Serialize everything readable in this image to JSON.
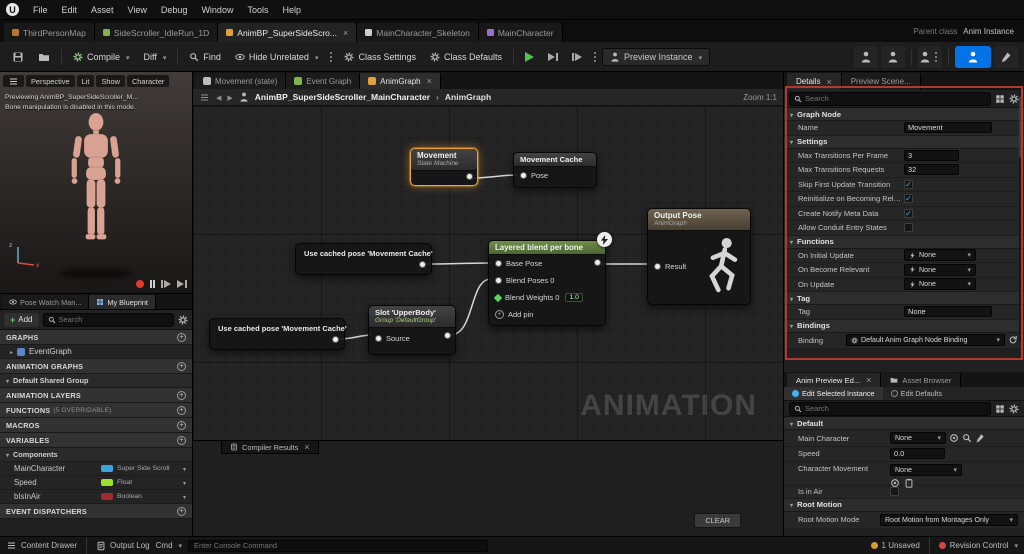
{
  "colors": {
    "accent_blue": "#0473e8",
    "selection_orange": "#f1a33a",
    "red_frame": "#b23a2d",
    "blend_green": "#6f904a",
    "pill_object": "#39a5dd",
    "pill_float": "#9ae42c",
    "pill_bool": "#9e2b2e"
  },
  "menubar": {
    "logo": "U",
    "items": [
      "File",
      "Edit",
      "Asset",
      "View",
      "Debug",
      "Window",
      "Tools",
      "Help"
    ]
  },
  "asset_tabs": {
    "tabs": [
      {
        "label": "ThirdPersonMap"
      },
      {
        "label": "SideScroller_IdleRun_1D"
      },
      {
        "label": "AnimBP_SuperSideScro..."
      },
      {
        "label": "MainCharacter_Skeleton"
      },
      {
        "label": "MainCharacter"
      }
    ],
    "parent_class_label": "Parent class",
    "parent_class_value": "Anim Instance"
  },
  "toolbar": {
    "compile_label": "Compile",
    "diff_label": "Diff",
    "find_label": "Find",
    "hide_unrelated_label": "Hide Unrelated",
    "class_settings_label": "Class Settings",
    "class_defaults_label": "Class Defaults",
    "preview_instance_label": "Preview Instance"
  },
  "viewport": {
    "menu_buttons": [
      "Perspective",
      "Lit",
      "Show",
      "Character"
    ],
    "preview_line1": "Previewing AnimBP_SuperSideScroller_M...",
    "preview_line2": "Bone manipulation is disabled in this mode.",
    "axis_x": "x",
    "axis_z": "z"
  },
  "left_panel": {
    "tab_pose_watch": "Pose Watch Man...",
    "tab_my_blueprint": "My Blueprint",
    "add_label": "Add",
    "search_placeholder": "Search",
    "graphs_header": "GRAPHS",
    "event_graph": "EventGraph",
    "animation_graphs_header": "ANIMATION GRAPHS",
    "default_shared_group": "Default Shared Group",
    "animation_layers_header": "ANIMATION LAYERS",
    "functions_header": "FUNCTIONS",
    "functions_suffix": "(5 OVERRIDABLE)",
    "macros_header": "MACROS",
    "variables_header": "VARIABLES",
    "components_label": "Components",
    "variables": [
      {
        "name": "MainCharacter",
        "type": "Super Side Scroll"
      },
      {
        "name": "Speed",
        "type": "Float"
      },
      {
        "name": "bIsInAir",
        "type": "Boolean"
      }
    ],
    "event_dispatchers_header": "EVENT DISPATCHERS"
  },
  "graph": {
    "tabs": [
      {
        "label": "Movement (state)"
      },
      {
        "label": "Event Graph"
      },
      {
        "label": "AnimGraph"
      }
    ],
    "breadcrumb_root": "AnimBP_SuperSideScroller_MainCharacter",
    "breadcrumb_sep": "›",
    "breadcrumb_current": "AnimGraph",
    "zoom_label": "Zoom 1:1",
    "watermark": "ANIMATION",
    "nodes": {
      "movement": {
        "title": "Movement",
        "subtitle": "State Machine"
      },
      "movement_cache": {
        "title": "Movement Cache",
        "pin": "Pose"
      },
      "cached_pose_top": {
        "title": "Use cached pose 'Movement Cache'"
      },
      "cached_pose_bottom": {
        "title": "Use cached pose 'Movement Cache'"
      },
      "layered_blend": {
        "title": "Layered blend per bone",
        "pin_base": "Base Pose",
        "pin_blend_poses": "Blend Poses 0",
        "pin_blend_weights": "Blend Weights 0",
        "weight_value": "1.0",
        "add_pin": "Add pin"
      },
      "output_pose": {
        "title": "Output Pose",
        "subtitle": "AnimGraph",
        "pin": "Result"
      },
      "slot": {
        "title": "Slot 'UpperBody'",
        "subtitle": "Group 'DefaultGroup'",
        "pin": "Source"
      }
    },
    "compiler_tab": "Compiler Results",
    "clear_label": "CLEAR"
  },
  "details": {
    "tab_details": "Details",
    "tab_preview_scene": "Preview Scene...",
    "search_placeholder": "Search",
    "graph_node_header": "Graph Node",
    "name_label": "Name",
    "name_value": "Movement",
    "settings_header": "Settings",
    "rows": {
      "max_transitions_label": "Max Transitions Per Frame",
      "max_transitions_value": "3",
      "max_requests_label": "Max Transitions Requests",
      "max_requests_value": "32",
      "skip_first_label": "Skip First Update Transition",
      "reinit_label": "Reinitialize on Becoming Relev...",
      "notify_label": "Create Notify Meta Data",
      "conduit_label": "Allow Conduit Entry States"
    },
    "functions_header": "Functions",
    "fn_initial_label": "On Initial Update",
    "fn_relevant_label": "On Become Relevant",
    "fn_update_label": "On Update",
    "fn_value": "None",
    "tag_header": "Tag",
    "tag_label": "Tag",
    "tag_value": "None",
    "bindings_header": "Bindings",
    "binding_label": "Binding",
    "binding_value": "Default Anim Graph Node Binding"
  },
  "anim_preview": {
    "tab_anim_preview": "Anim Preview Ed...",
    "tab_asset_browser": "Asset Browser",
    "edit_selected": "Edit Selected Instance",
    "edit_defaults": "Edit Defaults",
    "search_placeholder": "Search",
    "default_header": "Default",
    "main_character_label": "Main Character",
    "main_character_value": "None",
    "speed_label": "Speed",
    "speed_value": "0.0",
    "char_move_label": "Character Movement",
    "char_move_value": "None",
    "is_in_air_label": "Is in Air",
    "root_motion_header": "Root Motion",
    "root_motion_label": "Root Motion Mode",
    "root_motion_value": "Root Motion from Montages Only"
  },
  "statusbar": {
    "content_drawer": "Content Drawer",
    "output_log": "Output Log",
    "cmd": "Cmd",
    "console_placeholder": "Enter Console Command",
    "unsaved": "1 Unsaved",
    "revision": "Revision Control"
  }
}
